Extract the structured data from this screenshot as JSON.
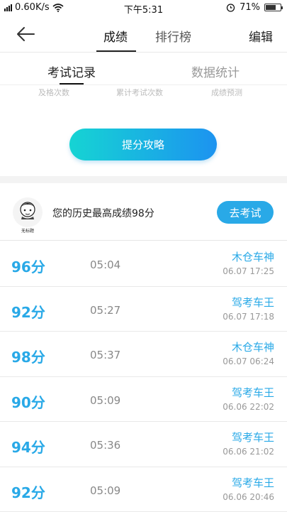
{
  "status": {
    "speed": "0.60K/s",
    "time": "下午5:31",
    "battery": "71%",
    "battery_level": 0.71
  },
  "nav": {
    "tab1": "成绩",
    "tab2": "排行榜",
    "edit": "编辑"
  },
  "subtabs": {
    "records": "考试记录",
    "stats": "数据统计"
  },
  "cut_labels": [
    "及格次数",
    "累计考试次数",
    "成绩预测"
  ],
  "strategy_button": "提分攻略",
  "best": {
    "avatar_caption": "无标题",
    "text": "您的历史最高成绩98分",
    "button": "去考试"
  },
  "records": [
    {
      "score": "96分",
      "duration": "05:04",
      "title": "木仓车神",
      "date": "06.07  17:25"
    },
    {
      "score": "92分",
      "duration": "05:27",
      "title": "驾考车王",
      "date": "06.07  17:18"
    },
    {
      "score": "98分",
      "duration": "05:37",
      "title": "木仓车神",
      "date": "06.07  06:24"
    },
    {
      "score": "90分",
      "duration": "05:09",
      "title": "驾考车王",
      "date": "06.06  22:02"
    },
    {
      "score": "94分",
      "duration": "05:36",
      "title": "驾考车王",
      "date": "06.06  21:02"
    },
    {
      "score": "92分",
      "duration": "05:09",
      "title": "驾考车王",
      "date": "06.06  20:46"
    }
  ],
  "icons": {
    "back": "arrow-left-icon",
    "wifi": "wifi-icon",
    "signal": "signal-icon",
    "alarm": "alarm-icon",
    "battery": "battery-icon"
  }
}
